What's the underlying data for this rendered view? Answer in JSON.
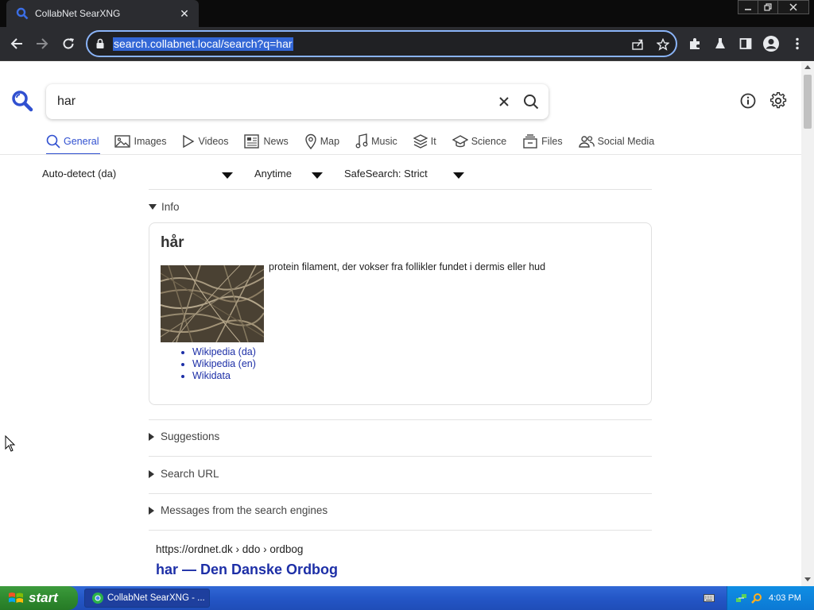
{
  "browser": {
    "tab_title": "CollabNet SearXNG",
    "tab_close": "✕",
    "url": "search.collabnet.local/search?q=har",
    "accent": "#8ab4f8"
  },
  "search": {
    "query": "har"
  },
  "categories": [
    {
      "label": "General",
      "active": true
    },
    {
      "label": "Images"
    },
    {
      "label": "Videos"
    },
    {
      "label": "News"
    },
    {
      "label": "Map"
    },
    {
      "label": "Music"
    },
    {
      "label": "It"
    },
    {
      "label": "Science"
    },
    {
      "label": "Files"
    },
    {
      "label": "Social Media"
    }
  ],
  "filters": {
    "language": "Auto-detect (da)",
    "time": "Anytime",
    "safesearch": "SafeSearch: Strict"
  },
  "infobox": {
    "toggle_label": "Info",
    "term": "hår",
    "description": "protein filament, der vokser fra follikler fundet i dermis eller hud",
    "links": [
      "Wikipedia (da)",
      "Wikipedia (en)",
      "Wikidata"
    ]
  },
  "sections": {
    "suggestions": "Suggestions",
    "search_url": "Search URL",
    "messages": "Messages from the search engines"
  },
  "result": {
    "url": "https://ordnet.dk  › ddo › ordbog",
    "title": "har — Den Danske Ordbog"
  },
  "taskbar": {
    "start_label": "start",
    "task_label": "CollabNet SearXNG - ...",
    "clock": "4:03 PM"
  }
}
